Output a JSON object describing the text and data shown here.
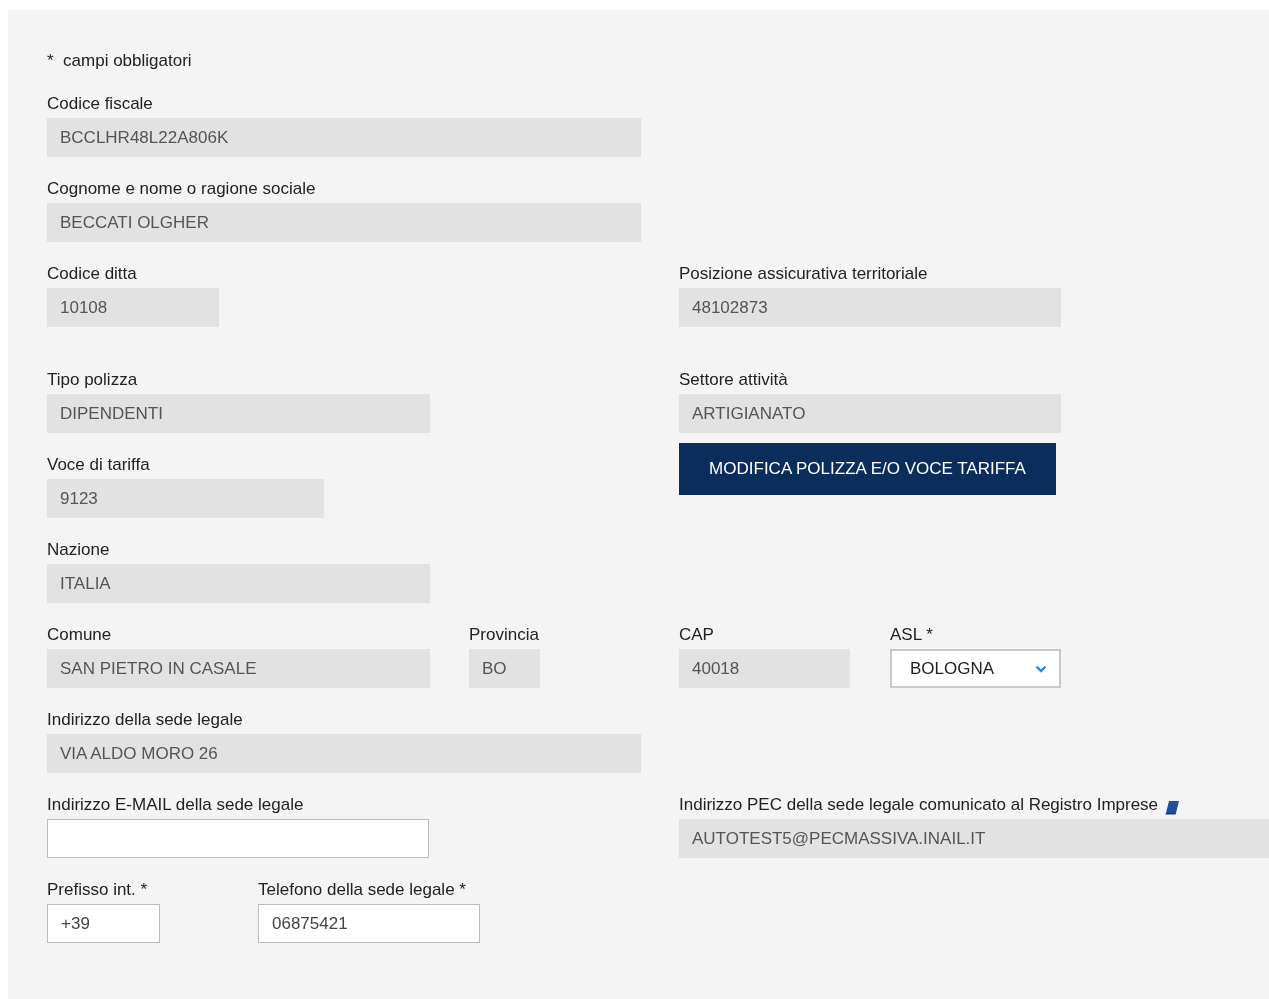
{
  "note": "*  campi obbligatori",
  "rows": [
    {
      "fields": [
        {
          "kind": "readonly",
          "label": "Codice fiscale",
          "value": "BCCLHR48L22A806K"
        }
      ]
    },
    {
      "fields": [
        {
          "kind": "readonly",
          "label": "Cognome e nome o ragione sociale",
          "value": "BECCATI OLGHER"
        }
      ]
    },
    {
      "fields": [
        {
          "kind": "readonly",
          "label": "Codice ditta",
          "value": "10108"
        },
        {
          "kind": "readonly",
          "label": "Posizione assicurativa territoriale",
          "value": "48102873"
        }
      ]
    },
    {
      "fields": [
        {
          "kind": "readonly",
          "label": "Tipo polizza",
          "value": "DIPENDENTI"
        },
        {
          "kind": "readonly",
          "label": "Settore attività",
          "value": "ARTIGIANATO"
        }
      ]
    },
    {
      "fields": [
        {
          "kind": "readonly",
          "label": "Voce di tariffa",
          "value": "9123"
        },
        {
          "kind": "button",
          "value": "MODIFICA POLIZZA E/O VOCE TARIFFA"
        }
      ]
    },
    {
      "fields": [
        {
          "kind": "readonly",
          "label": "Nazione",
          "value": "ITALIA"
        }
      ]
    },
    {
      "fields": [
        {
          "kind": "readonly",
          "label": "Comune",
          "value": "SAN PIETRO IN CASALE"
        },
        {
          "kind": "readonly",
          "label": "Provincia",
          "value": "BO"
        },
        {
          "kind": "readonly",
          "label": "CAP",
          "value": "40018"
        },
        {
          "kind": "select",
          "label": "ASL *",
          "value": "BOLOGNA"
        }
      ]
    },
    {
      "fields": [
        {
          "kind": "readonly",
          "label": "Indirizzo della sede legale",
          "value": "VIA ALDO MORO 26"
        }
      ]
    },
    {
      "fields": [
        {
          "kind": "input",
          "label": "Indirizzo E-MAIL della sede legale"
        },
        {
          "kind": "readonly",
          "label": "Indirizzo PEC della sede legale comunicato al Registro Imprese",
          "info": true,
          "value": "AUTOTEST5@PECMASSIVA.INAIL.IT"
        }
      ]
    },
    {
      "fields": [
        {
          "kind": "input",
          "label": "Prefisso int. *",
          "value": "+39"
        },
        {
          "kind": "input",
          "label": "Telefono della sede legale *",
          "value": "06875421"
        }
      ]
    }
  ]
}
